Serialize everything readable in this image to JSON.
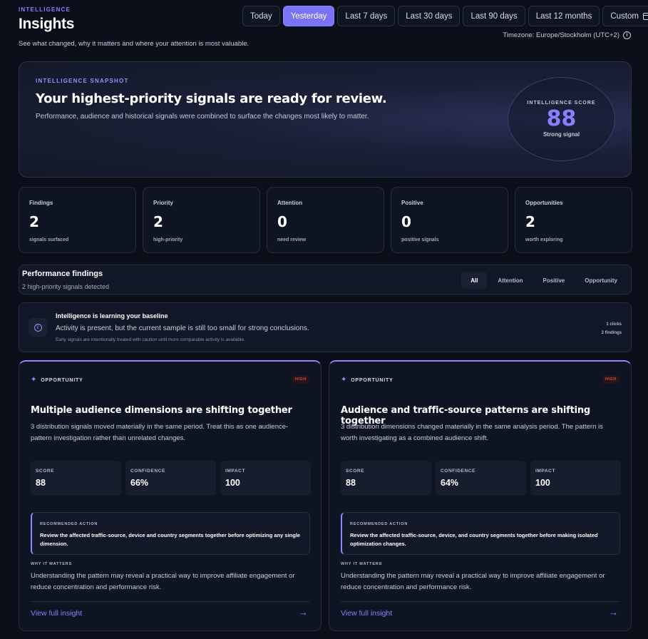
{
  "header": {
    "eyebrow": "INTELLIGENCE",
    "title": "Insights",
    "subtitle": "See what changed, why it matters and where your attention is most valuable.",
    "timezone": "Timezone: Europe/Stockholm (UTC+2)"
  },
  "date_ranges": [
    "Today",
    "Yesterday",
    "Last 7 days",
    "Last 30 days",
    "Last 90 days",
    "Last 12 months",
    "Custom"
  ],
  "active_range": "Yesterday",
  "snapshot": {
    "eyebrow": "INTELLIGENCE SNAPSHOT",
    "title": "Your highest-priority signals are ready for review.",
    "subtitle": "Performance, audience and historical signals were combined to surface the changes most likely to matter.",
    "score_label": "INTELLIGENCE SCORE",
    "score_value": "88",
    "score_caption": "Strong signal"
  },
  "stats": [
    {
      "label": "Findings",
      "value": "2",
      "note": "signals surfaced"
    },
    {
      "label": "Priority",
      "value": "2",
      "note": "high-priority"
    },
    {
      "label": "Attention",
      "value": "0",
      "note": "need review"
    },
    {
      "label": "Positive",
      "value": "0",
      "note": "positive signals"
    },
    {
      "label": "Opportunities",
      "value": "2",
      "note": "worth exploring"
    }
  ],
  "findings": {
    "title": "Performance findings",
    "subtitle": "2 high-priority signals detected",
    "filters": [
      "All",
      "Attention",
      "Positive",
      "Opportunity"
    ],
    "active_filter": "All"
  },
  "learning": {
    "title": "Intelligence is learning your baseline",
    "text": "Activity is present, but the current sample is still too small for strong conclusions.",
    "note": "Early signals are intentionally treated with caution until more comparable activity is available.",
    "clicks": "1 clicks",
    "findings_count": "2 findings"
  },
  "insights": [
    {
      "tag": "OPPORTUNITY",
      "badge": "HIGH",
      "title": "Multiple audience dimensions are shifting together",
      "description": "3 distribution signals moved materially in the same period. Treat this as one audience-pattern investigation rather than unrelated changes.",
      "metrics": [
        {
          "label": "SCORE",
          "value": "88"
        },
        {
          "label": "CONFIDENCE",
          "value": "66%"
        },
        {
          "label": "IMPACT",
          "value": "100"
        }
      ],
      "rec_label": "RECOMMENDED ACTION",
      "rec_text": "Review the affected traffic-source, device and country segments together before optimizing any single dimension.",
      "why_label": "WHY IT MATTERS",
      "why_text": "Understanding the pattern may reveal a practical way to improve affiliate engagement or reduce concentration and performance risk.",
      "link": "View full insight"
    },
    {
      "tag": "OPPORTUNITY",
      "badge": "HIGH",
      "title": "Audience and traffic-source patterns are shifting together",
      "description": "3 distribution dimensions changed materially in the same analysis period. The pattern is worth investigating as a combined audience shift.",
      "metrics": [
        {
          "label": "SCORE",
          "value": "88"
        },
        {
          "label": "CONFIDENCE",
          "value": "64%"
        },
        {
          "label": "IMPACT",
          "value": "100"
        }
      ],
      "rec_label": "RECOMMENDED ACTION",
      "rec_text": "Review the affected traffic-source, device, and country segments together before making isolated optimization changes.",
      "why_label": "WHY IT MATTERS",
      "why_text": "Understanding the pattern may reveal a practical way to improve affiliate engagement or reduce concentration and performance risk.",
      "link": "View full insight"
    }
  ],
  "colors": {
    "accent": "#7b73f5",
    "background": "#0b0f1a",
    "card": "#0f1422",
    "badge_red": "#d64b4b"
  }
}
